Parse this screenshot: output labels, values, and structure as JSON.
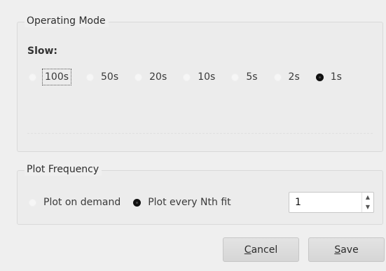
{
  "operating_mode": {
    "title": "Operating Mode",
    "sub_label": "Slow:",
    "options": [
      {
        "label": "100s",
        "checked": false,
        "focused": true
      },
      {
        "label": "50s",
        "checked": false,
        "focused": false
      },
      {
        "label": "20s",
        "checked": false,
        "focused": false
      },
      {
        "label": "10s",
        "checked": false,
        "focused": false
      },
      {
        "label": "5s",
        "checked": false,
        "focused": false
      },
      {
        "label": "2s",
        "checked": false,
        "focused": false
      },
      {
        "label": "1s",
        "checked": true,
        "focused": false
      }
    ]
  },
  "plot_frequency": {
    "title": "Plot Frequency",
    "options": [
      {
        "label": "Plot on demand",
        "checked": false
      },
      {
        "label": "Plot every Nth fit",
        "checked": true
      }
    ],
    "n_value": "1"
  },
  "buttons": {
    "cancel_first": "C",
    "cancel_rest": "ancel",
    "save_first": "S",
    "save_rest": "ave"
  },
  "icons": {
    "spin_up": "triangle-up-icon",
    "spin_down": "triangle-down-icon"
  }
}
